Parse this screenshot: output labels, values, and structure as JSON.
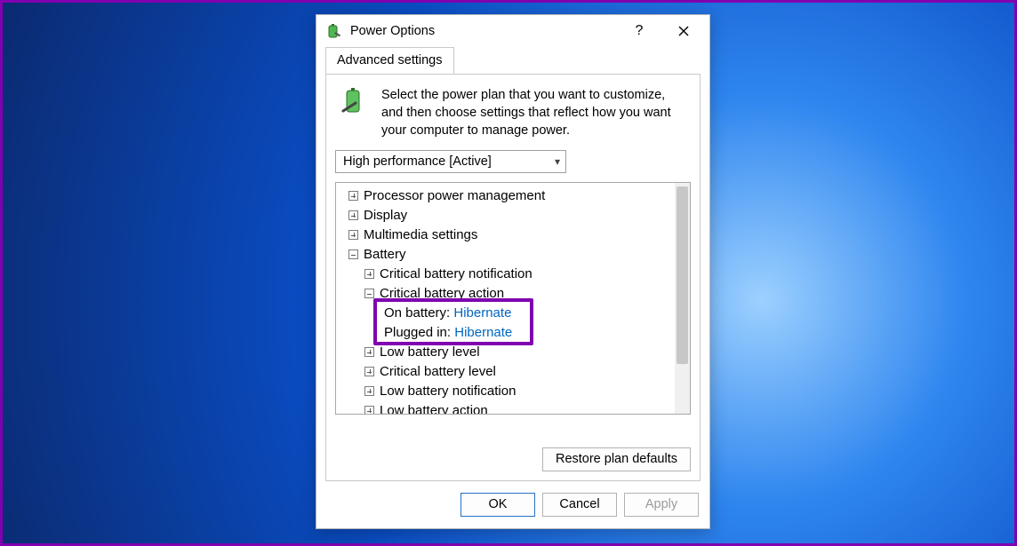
{
  "window": {
    "title": "Power Options",
    "help_tooltip": "?",
    "close_tooltip": "Close"
  },
  "tabs": {
    "advanced": "Advanced settings"
  },
  "description": "Select the power plan that you want to customize, and then choose settings that reflect how you want your computer to manage power.",
  "plan": {
    "selected": "High performance [Active]"
  },
  "tree": {
    "processor": "Processor power management",
    "display": "Display",
    "multimedia": "Multimedia settings",
    "battery": "Battery",
    "crit_notif": "Critical battery notification",
    "crit_action": "Critical battery action",
    "on_batt_label": "On battery:",
    "on_batt_value": "Hibernate",
    "plugged_label": "Plugged in:",
    "plugged_value": "Hibernate",
    "low_level": "Low battery level",
    "crit_level": "Critical battery level",
    "low_notif": "Low battery notification",
    "low_action": "Low battery action"
  },
  "buttons": {
    "restore": "Restore plan defaults",
    "ok": "OK",
    "cancel": "Cancel",
    "apply": "Apply"
  }
}
